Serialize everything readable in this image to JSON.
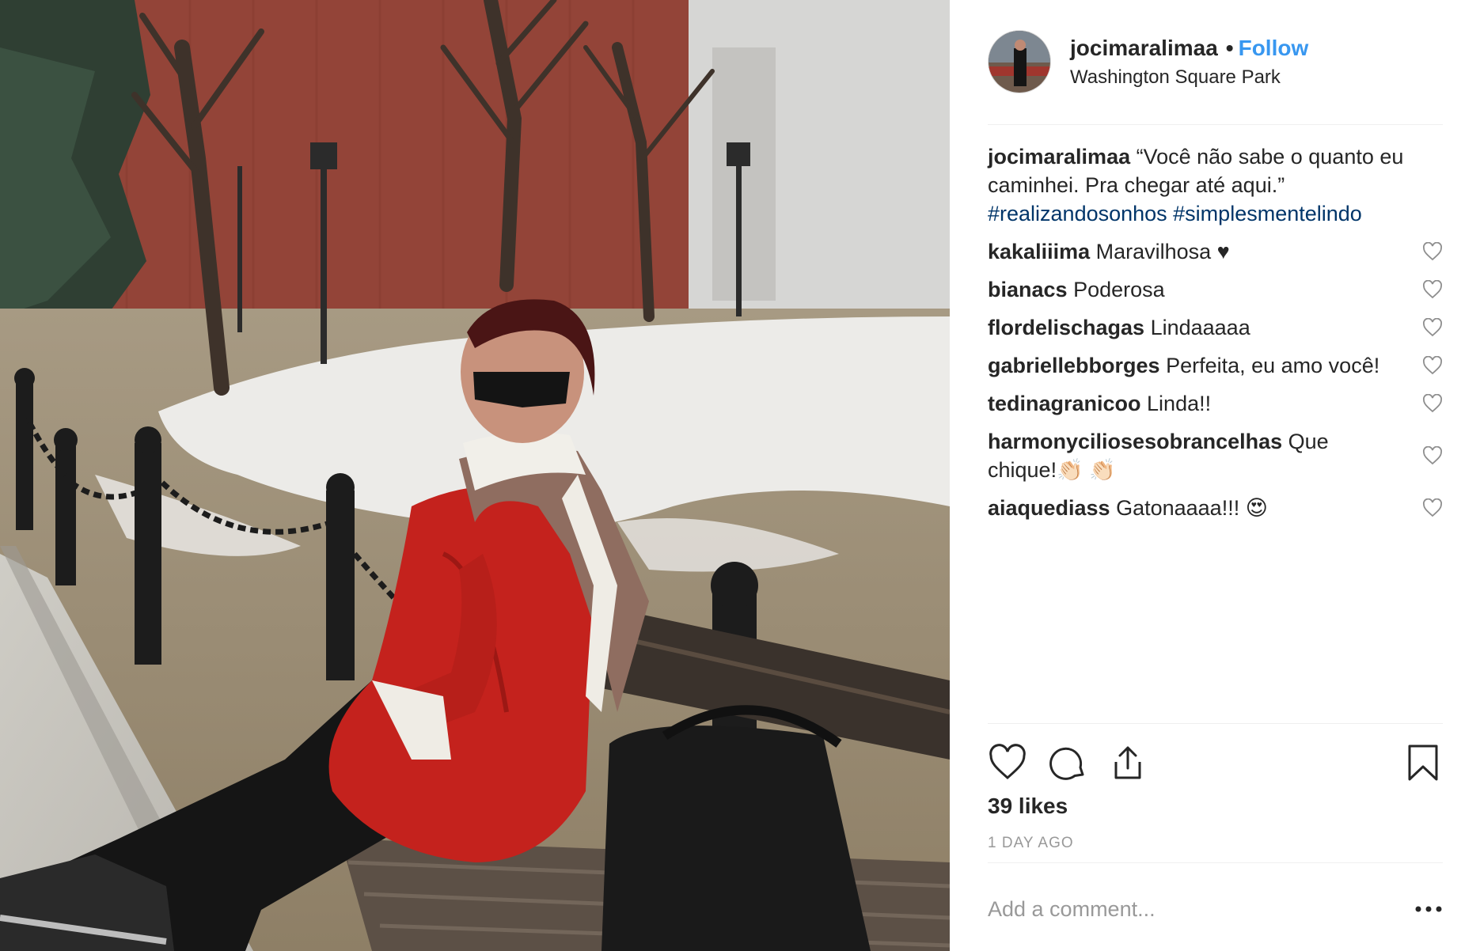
{
  "post": {
    "username": "jocimaralimaa",
    "separator": "•",
    "follow_label": "Follow",
    "location": "Washington Square Park",
    "caption": {
      "username": "jocimaralimaa",
      "text": " “Você não sabe o quanto eu caminhei. Pra chegar até aqui.” ",
      "hashtags": "#realizandosonhos #simplesmentelindo"
    },
    "comments": [
      {
        "username": "kakaliiima",
        "text": " Maravilhosa ♥"
      },
      {
        "username": "bianacs",
        "text": " Poderosa"
      },
      {
        "username": "flordelischagas",
        "text": " Lindaaaaa"
      },
      {
        "username": "gabriellebborges",
        "text": " Perfeita, eu amo você!"
      },
      {
        "username": "tedinagranicoo",
        "text": " Linda!!"
      },
      {
        "username": "harmonyciliosesobrancelhas",
        "text": " Que chique!👏🏻 👏🏻"
      },
      {
        "username": "aiaquediass",
        "text": " Gatonaaaa!!! 😍"
      }
    ],
    "likes": "39 likes",
    "timestamp": "1 DAY AGO",
    "add_comment_placeholder": "Add a comment..."
  },
  "icons": {
    "like": "heart-icon",
    "comment": "comment-bubble-icon",
    "share": "share-icon",
    "save": "bookmark-icon",
    "more": "more-options-icon",
    "comment_like": "heart-outline-icon"
  },
  "colors": {
    "link": "#3897f0",
    "hashtag": "#003569",
    "text": "#262626",
    "muted": "#999999",
    "divider": "#efefef"
  }
}
